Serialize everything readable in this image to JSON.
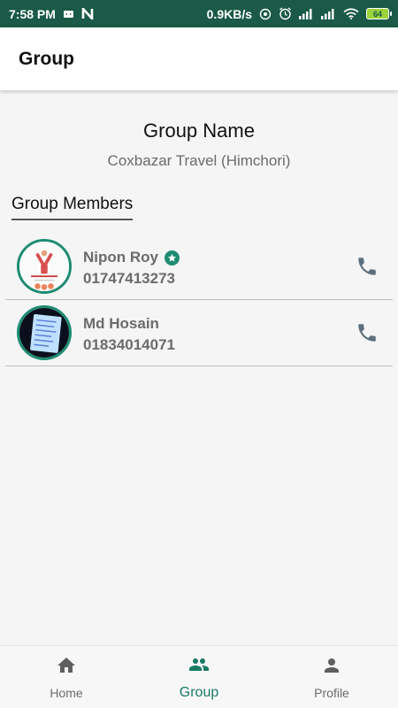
{
  "status_bar": {
    "time": "7:58 PM",
    "speed": "0.9KB/s",
    "battery": "64",
    "icons": [
      "android-icon",
      "n-notification-icon",
      "hotspot-icon",
      "alarm-icon",
      "signal-icon",
      "signal-icon",
      "wifi-icon",
      "battery-icon"
    ]
  },
  "app_bar": {
    "title": "Group"
  },
  "group": {
    "name_label": "Group Name",
    "name_value": "Coxbazar Travel (Himchori)",
    "members_header": "Group Members"
  },
  "members": [
    {
      "name": "Nipon Roy",
      "phone": "01747413273",
      "is_admin": true,
      "icon": "call-icon"
    },
    {
      "name": "Md Hosain",
      "phone": "01834014071",
      "is_admin": false,
      "icon": "call-icon"
    }
  ],
  "bottom_nav": [
    {
      "label": "Home",
      "icon": "home-icon",
      "active": false
    },
    {
      "label": "Group",
      "icon": "group-icon",
      "active": true
    },
    {
      "label": "Profile",
      "icon": "profile-icon",
      "active": false
    }
  ],
  "colors": {
    "status_bar_bg": "#1a5a47",
    "accent": "#1a7a66",
    "icon_gray": "#5b6f7e",
    "text_gray": "#6b6b6b"
  }
}
